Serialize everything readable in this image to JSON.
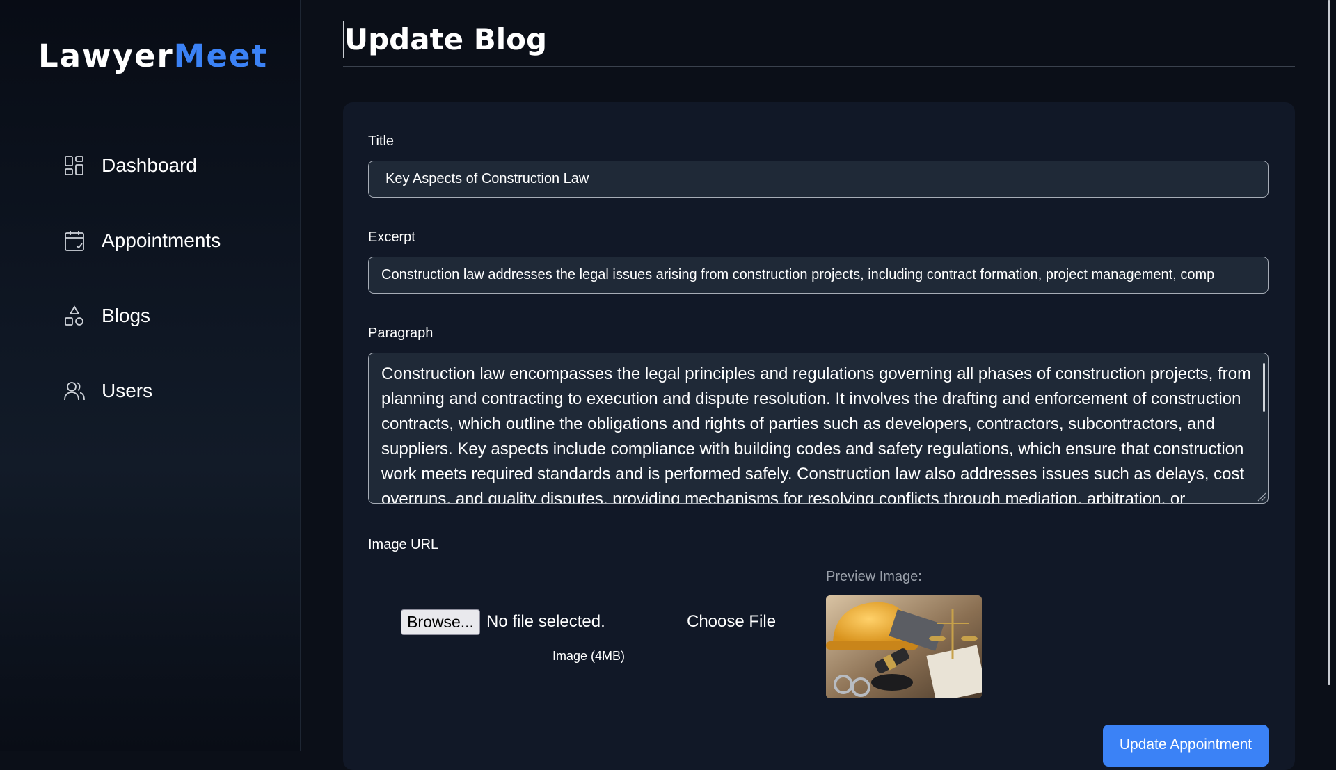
{
  "brand": {
    "part1": "Lawyer",
    "part2": "Meet",
    "accent": "#3b82f6"
  },
  "sidebar": {
    "items": [
      {
        "label": "Dashboard",
        "icon": "dashboard-grid-icon"
      },
      {
        "label": "Appointments",
        "icon": "calendar-check-icon"
      },
      {
        "label": "Blogs",
        "icon": "shapes-icon"
      },
      {
        "label": "Users",
        "icon": "users-icon"
      }
    ]
  },
  "page": {
    "title": "Update Blog"
  },
  "form": {
    "title_label": "Title",
    "title_value": "Key Aspects of Construction Law",
    "excerpt_label": "Excerpt",
    "excerpt_value": "Construction law addresses the legal issues arising from construction projects, including contract formation, project management, comp",
    "paragraph_label": "Paragraph",
    "paragraph_value": "Construction law encompasses the legal principles and regulations governing all phases of construction projects, from planning and contracting to execution and dispute resolution. It involves the drafting and enforcement of construction contracts, which outline the obligations and rights of parties such as developers, contractors, subcontractors, and suppliers. Key aspects include compliance with building codes and safety regulations, which ensure that construction work meets required standards and is performed safely. Construction law also addresses issues such as delays, cost overruns, and quality disputes, providing mechanisms for resolving conflicts through mediation, arbitration, or",
    "image_label": "Image URL",
    "browse_label": "Browse...",
    "no_file_text": "No file selected.",
    "choose_file_text": "Choose File",
    "image_note": "Image (4MB)",
    "preview_label": "Preview Image:",
    "submit_label": "Update Appointment"
  }
}
